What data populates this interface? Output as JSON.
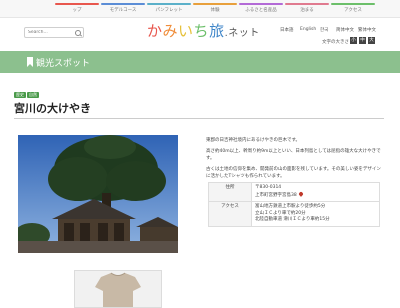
{
  "topnav": {
    "items": [
      {
        "label": "ップ",
        "color": "#e8574e"
      },
      {
        "label": "モデルコース",
        "color": "#5b8dd6"
      },
      {
        "label": "パンフレット",
        "color": "#5bb0c9"
      },
      {
        "label": "体験",
        "color": "#e8a03c"
      },
      {
        "label": "ふるさと名産品",
        "color": "#b36ad6"
      },
      {
        "label": "泊まる",
        "color": "#e07a8f"
      },
      {
        "label": "アクセス",
        "color": "#6cbf6a"
      }
    ]
  },
  "header": {
    "search_placeholder": "Search...",
    "logo": {
      "chars": [
        {
          "c": "か",
          "color": "#e8574e"
        },
        {
          "c": "み",
          "color": "#f08d3a"
        },
        {
          "c": "い",
          "color": "#e6c13b"
        },
        {
          "c": "ち",
          "color": "#6cbf6a"
        },
        {
          "c": "旅",
          "color": "#3f86c9"
        },
        {
          "c": ".",
          "color": "#666666"
        },
        {
          "c": "ネ",
          "color": "#555555"
        },
        {
          "c": "ッ",
          "color": "#555555"
        },
        {
          "c": "ト",
          "color": "#555555"
        }
      ]
    },
    "languages_row1": [
      "日本語",
      "English"
    ],
    "languages_row2": [
      "한국",
      "简体中文",
      "繁体中文"
    ],
    "font_size_label": "文字の大きさ",
    "font_size_buttons": [
      "小",
      "中",
      "大"
    ]
  },
  "category": {
    "title": "観光スポット"
  },
  "article": {
    "tags": [
      "歴史",
      "自然"
    ],
    "title": "宮川の大けやき",
    "description": [
      "東郡の日吉神社境内にあるけやきの巨木です。",
      "高さ約40m以上、幹周り約9m以上といい、日本列島としては屈指の雄大な大けやきです。",
      "古くは土地の信仰を集め、開発前の山の面影を残しています。その美しい姿をデザインに活かしたTシャツも作られています。"
    ],
    "info": [
      {
        "key": "住所",
        "lines": [
          "〒830-0314",
          "上市町宮野字宮島38"
        ],
        "map": ""
      },
      {
        "key": "アクセス",
        "lines": [
          "富山地方鉄道上市駅より徒歩約5分",
          "立山ＩＣより車で約20分",
          "北陸自動車道 滑川ＩＣより車約15分"
        ],
        "map": ""
      }
    ]
  },
  "colors": {
    "band": "#8cc08e",
    "tag": "#4a9a4a",
    "sky": "#3a6fc1"
  }
}
